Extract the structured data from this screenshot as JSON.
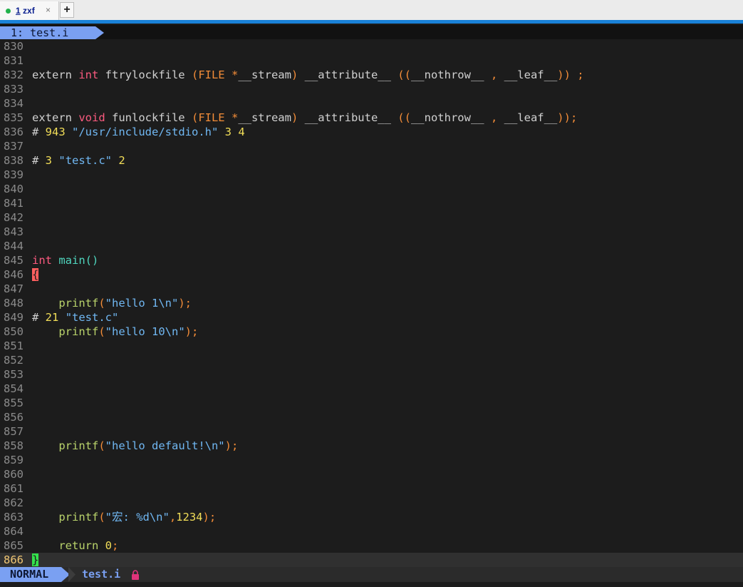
{
  "terminal": {
    "tab": {
      "number": "1",
      "name": "zxf",
      "close": "×"
    },
    "add_tab": "+"
  },
  "vim": {
    "tabline": "1: test.i",
    "mode": "NORMAL",
    "filename": "test.i",
    "lock_icon": "lock-icon",
    "current_line": "866"
  },
  "lines": [
    {
      "n": "830",
      "t": []
    },
    {
      "n": "831",
      "t": []
    },
    {
      "n": "832",
      "t": [
        [
          "n",
          "extern "
        ],
        [
          "k",
          "int"
        ],
        [
          "n",
          " ftrylockfile "
        ],
        [
          "o",
          "(FILE *"
        ],
        [
          "n",
          "__stream"
        ],
        [
          "o",
          ")"
        ],
        [
          "n",
          " __attribute__ "
        ],
        [
          "o",
          "(("
        ],
        [
          "n",
          "__nothrow__ "
        ],
        [
          "o",
          ","
        ],
        [
          "n",
          " __leaf__"
        ],
        [
          "o",
          ")) ;"
        ]
      ]
    },
    {
      "n": "833",
      "t": []
    },
    {
      "n": "834",
      "t": []
    },
    {
      "n": "835",
      "t": [
        [
          "n",
          "extern "
        ],
        [
          "k",
          "void"
        ],
        [
          "n",
          " funlockfile "
        ],
        [
          "o",
          "(FILE *"
        ],
        [
          "n",
          "__stream"
        ],
        [
          "o",
          ")"
        ],
        [
          "n",
          " __attribute__ "
        ],
        [
          "o",
          "(("
        ],
        [
          "n",
          "__nothrow__ "
        ],
        [
          "o",
          ","
        ],
        [
          "n",
          " __leaf__"
        ],
        [
          "o",
          "));"
        ]
      ]
    },
    {
      "n": "836",
      "t": [
        [
          "n",
          "# "
        ],
        [
          "y",
          "943"
        ],
        [
          "n",
          " "
        ],
        [
          "s",
          "\"/usr/include/stdio.h\""
        ],
        [
          "n",
          " "
        ],
        [
          "y",
          "3 4"
        ]
      ]
    },
    {
      "n": "837",
      "t": []
    },
    {
      "n": "838",
      "t": [
        [
          "n",
          "# "
        ],
        [
          "y",
          "3"
        ],
        [
          "n",
          " "
        ],
        [
          "s",
          "\"test.c\""
        ],
        [
          "n",
          " "
        ],
        [
          "y",
          "2"
        ]
      ]
    },
    {
      "n": "839",
      "t": []
    },
    {
      "n": "840",
      "t": []
    },
    {
      "n": "841",
      "t": []
    },
    {
      "n": "842",
      "t": []
    },
    {
      "n": "843",
      "t": []
    },
    {
      "n": "844",
      "t": []
    },
    {
      "n": "845",
      "t": [
        [
          "k",
          "int"
        ],
        [
          "n",
          " "
        ],
        [
          "f",
          "main()"
        ]
      ]
    },
    {
      "n": "846",
      "t": [
        [
          "c1",
          "{"
        ]
      ]
    },
    {
      "n": "847",
      "t": []
    },
    {
      "n": "848",
      "t": [
        [
          "n",
          "    "
        ],
        [
          "g",
          "printf"
        ],
        [
          "o",
          "("
        ],
        [
          "s",
          "\"hello 1\\n\""
        ],
        [
          "o",
          ");"
        ]
      ]
    },
    {
      "n": "849",
      "t": [
        [
          "n",
          "# "
        ],
        [
          "y",
          "21"
        ],
        [
          "n",
          " "
        ],
        [
          "s",
          "\"test.c\""
        ]
      ]
    },
    {
      "n": "850",
      "t": [
        [
          "n",
          "    "
        ],
        [
          "g",
          "printf"
        ],
        [
          "o",
          "("
        ],
        [
          "s",
          "\"hello 10\\n\""
        ],
        [
          "o",
          ");"
        ]
      ]
    },
    {
      "n": "851",
      "t": []
    },
    {
      "n": "852",
      "t": []
    },
    {
      "n": "853",
      "t": []
    },
    {
      "n": "854",
      "t": []
    },
    {
      "n": "855",
      "t": []
    },
    {
      "n": "856",
      "t": []
    },
    {
      "n": "857",
      "t": []
    },
    {
      "n": "858",
      "t": [
        [
          "n",
          "    "
        ],
        [
          "g",
          "printf"
        ],
        [
          "o",
          "("
        ],
        [
          "s",
          "\"hello default!\\n\""
        ],
        [
          "o",
          ");"
        ]
      ]
    },
    {
      "n": "859",
      "t": []
    },
    {
      "n": "860",
      "t": []
    },
    {
      "n": "861",
      "t": []
    },
    {
      "n": "862",
      "t": []
    },
    {
      "n": "863",
      "t": [
        [
          "n",
          "    "
        ],
        [
          "g",
          "printf"
        ],
        [
          "o",
          "("
        ],
        [
          "s",
          "\"宏: %d\\n\""
        ],
        [
          "o",
          ","
        ],
        [
          "y",
          "1234"
        ],
        [
          "o",
          ");"
        ]
      ]
    },
    {
      "n": "864",
      "t": []
    },
    {
      "n": "865",
      "t": [
        [
          "n",
          "    "
        ],
        [
          "g",
          "return"
        ],
        [
          "n",
          " "
        ],
        [
          "y",
          "0"
        ],
        [
          "o",
          ";"
        ]
      ]
    },
    {
      "n": "866",
      "t": [
        [
          "c2",
          "}"
        ]
      ]
    }
  ]
}
